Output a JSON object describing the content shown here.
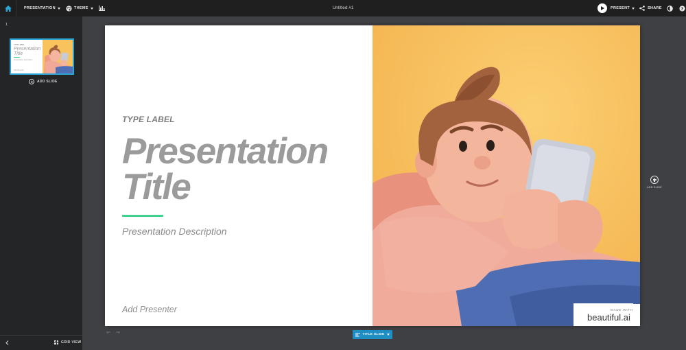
{
  "topbar": {
    "presentation_menu": "PRESENTATION",
    "theme_menu": "THEME",
    "doc_title": "Untitled #1",
    "present_label": "PRESENT",
    "share_label": "SHARE"
  },
  "sidebar": {
    "slide_number": "1",
    "add_slide_label": "ADD SLIDE",
    "grid_view_label": "GRID VIEW",
    "thumbnail": {
      "type_label": "TYPE LABEL",
      "title": "Presentation Title",
      "description": "Presentation Description",
      "presenter": "Add Presenter"
    }
  },
  "slide": {
    "type_label": "TYPE LABEL",
    "title_line1": "Presentation",
    "title_line2": "Title",
    "description": "Presentation Description",
    "presenter": "Add Presenter",
    "badge_made_with": "MADE WITH",
    "badge_brand": "beautiful.ai"
  },
  "layout_button_label": "TITLE SLIDE",
  "add_slide_right_label": "ADD SLIDE",
  "colors": {
    "accent_green": "#41d38e",
    "selection_blue": "#2aa6d6",
    "button_blue": "#1f8ec3",
    "image_background": "#f8c460"
  }
}
